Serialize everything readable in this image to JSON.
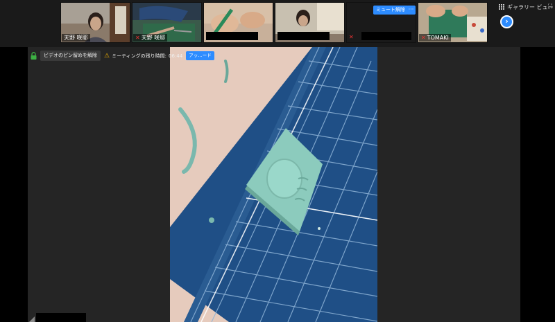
{
  "participants": [
    {
      "name": "天野 咲耶",
      "muted": false
    },
    {
      "name": "天野 咲耶",
      "muted": true
    },
    {
      "name": "",
      "muted": false
    },
    {
      "name": "",
      "muted": false
    },
    {
      "name": "",
      "muted": true,
      "unmute_label": "ミュート解除",
      "more_label": "···"
    },
    {
      "name": "TOMAKI",
      "muted": true
    }
  ],
  "gallery_view_label": "ギャラリー ビュー",
  "status_bar": {
    "unpin_label": "ビデオのピン留めを解除",
    "timer_label": "ミーティングの残り時間:",
    "timer_value": "06:44",
    "upgrade_label": "アッ…ード"
  },
  "icons": {
    "mute": "muted-mic-icon",
    "lock": "lock-icon",
    "warning": "warning-icon",
    "next": "chevron-right-icon",
    "grid": "grid-icon",
    "fullscreen": "fullscreen-icon"
  },
  "colors": {
    "accent": "#2d8cff",
    "warning": "#f5b400",
    "lock": "#3cb043",
    "mute": "#e33333"
  }
}
